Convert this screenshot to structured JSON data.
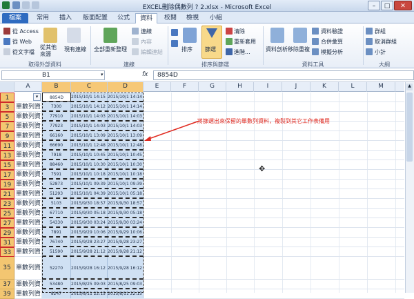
{
  "window": {
    "title": "EXCEL刪除偶數列 ? 2.xlsx - Microsoft Excel",
    "buttons": {
      "minimize": "–",
      "maximize": "□",
      "close": "✕"
    }
  },
  "tabs": [
    "檔案",
    "常用",
    "插入",
    "版面配置",
    "公式",
    "資料",
    "校閱",
    "檢視",
    "小組"
  ],
  "active_tab": "資料",
  "ribbon": {
    "external": {
      "items": [
        "從 Access",
        "從 Web",
        "從文字檔"
      ],
      "other_sources": "從其他\n來源",
      "existing": "現有連線",
      "group_label": "取得外部資料"
    },
    "connections": {
      "refresh": "全部重新整理",
      "items": [
        "連線",
        "內容",
        "編輯連結"
      ],
      "group_label": "連線"
    },
    "sort_filter": {
      "sort": "排序",
      "filter": "篩選",
      "items": [
        "清除",
        "重新套用",
        "進階..."
      ],
      "group_label": "排序與篩選"
    },
    "data_tools": {
      "text_to_columns": "資料剖析",
      "remove_duplicates": "移除重複",
      "items": [
        "資料驗證",
        "合併彙算",
        "模擬分析"
      ],
      "group_label": "資料工具"
    },
    "outline": {
      "items": [
        "群組",
        "取消群組",
        "小計"
      ],
      "group_label": "大綱"
    }
  },
  "formula_bar": {
    "name_box": "B1",
    "fx": "fx",
    "value": "8854D"
  },
  "columns": [
    "A",
    "B",
    "C",
    "D",
    "E",
    "F",
    "G",
    "H",
    "I",
    "J",
    "K",
    "L",
    "M"
  ],
  "selected_columns": [
    "B",
    "C",
    "D"
  ],
  "rows": [
    {
      "num": "1",
      "a": "",
      "b": "8854D",
      "c": "2015/10/1 14:15",
      "d": "2015/10/1 14:14"
    },
    {
      "num": "3",
      "a": "單數列資",
      "b": "7300",
      "c": "2015/10/1 14:12",
      "d": "2015/10/1 14:14"
    },
    {
      "num": "5",
      "a": "單數列資",
      "b": "77910",
      "c": "2015/10/1 14:03",
      "d": "2015/10/1 14:03"
    },
    {
      "num": "7",
      "a": "單數列資",
      "b": "77923",
      "c": "2015/10/1 14:03",
      "d": "2015/10/1 14:03"
    },
    {
      "num": "9",
      "a": "單數列資",
      "b": "66160",
      "c": "2015/10/1 13:09",
      "d": "2015/10/1 13:09"
    },
    {
      "num": "11",
      "a": "單數列資",
      "b": "66690",
      "c": "2015/10/1 12:48",
      "d": "2015/10/1 12:48"
    },
    {
      "num": "13",
      "a": "單數列資",
      "b": "7918",
      "c": "2015/10/1 10:45",
      "d": "2015/10/1 10:45"
    },
    {
      "num": "15",
      "a": "單數列資",
      "b": "88460",
      "c": "2015/10/1 10:30",
      "d": "2015/10/1 10:30"
    },
    {
      "num": "17",
      "a": "單數列資",
      "b": "7591",
      "c": "2015/10/1 10:18",
      "d": "2015/10/1 10:18"
    },
    {
      "num": "19",
      "a": "單數列資",
      "b": "52873",
      "c": "2015/10/1 09:39",
      "d": "2015/10/1 09:39"
    },
    {
      "num": "21",
      "a": "單數列資",
      "b": "51293",
      "c": "2015/10/1 04:39",
      "d": "2015/10/1 05:18"
    },
    {
      "num": "23",
      "a": "單數列資",
      "b": "5103",
      "c": "2015/9/30 18:57",
      "d": "2015/9/30 18:57"
    },
    {
      "num": "25",
      "a": "單數列資",
      "b": "67710",
      "c": "2015/9/30 05:18",
      "d": "2015/9/30 05:18"
    },
    {
      "num": "27",
      "a": "單數列資",
      "b": "54330",
      "c": "2015/9/30 03:24",
      "d": "2015/9/30 03:24"
    },
    {
      "num": "29",
      "a": "單數列資",
      "b": "7891",
      "c": "2015/9/29 10:06",
      "d": "2015/9/29 10:06"
    },
    {
      "num": "31",
      "a": "單數列資",
      "b": "76740",
      "c": "2015/9/28 23:27",
      "d": "2015/9/28 23:27"
    },
    {
      "num": "33",
      "a": "單數列資",
      "b": "51590",
      "c": "2015/9/28 21:12",
      "d": "2015/9/28 21:12"
    },
    {
      "num": "35",
      "a": "單數列資",
      "b": "52270",
      "c": "2015/9/28 16:12",
      "d": "2015/9/28 16:12"
    },
    {
      "num": "37",
      "a": "單數列資",
      "b": "53480",
      "c": "2015/8/25 09:03",
      "d": "2015/8/25 09:03"
    },
    {
      "num": "39",
      "a": "單數列資",
      "b": "8247",
      "c": "2015/8/11 22:15",
      "d": "2015/8/11 22:15"
    }
  ],
  "annotation": "將篩選出來保留的單數列資料，複製到其它工作表備用",
  "colors": {
    "accent": "#e0291f",
    "selection": "#cfe0f3",
    "header_selected": "#f6c877"
  }
}
